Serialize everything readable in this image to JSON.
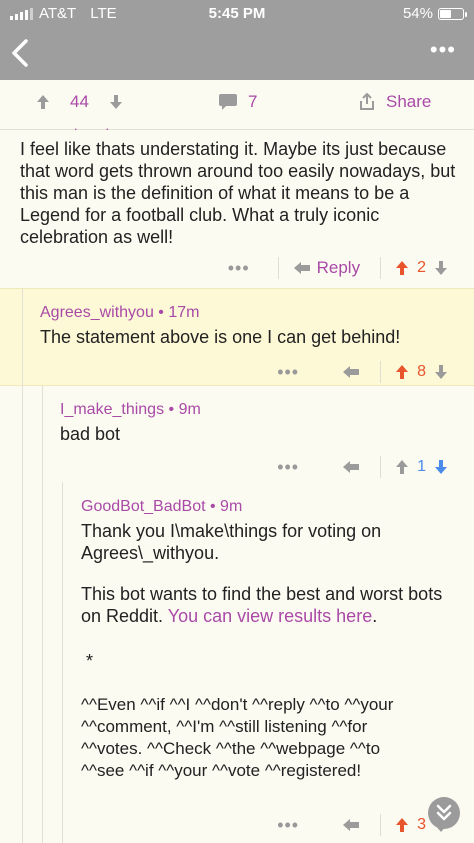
{
  "status_bar": {
    "carrier": "AT&T",
    "network": "LTE",
    "time": "5:45 PM",
    "battery": "54%",
    "battery_level": 0.54
  },
  "post_bar": {
    "upvotes": "44",
    "comments": "7",
    "share_label": "Share"
  },
  "colors": {
    "accent": "#a94aa7",
    "upvote": "#e8542b",
    "downvote": "#4a8bec",
    "icon_grey": "#9b9b9b"
  },
  "comments": [
    {
      "body": "I feel like thats understating it. Maybe its just because that word gets thrown around too easily nowadays, but this man is the definition of what it means to be a Legend for a football club. What a truly iconic celebration as well!",
      "reply_label": "Reply",
      "score": "2",
      "vote_state": "upvoted"
    },
    {
      "author": "Agrees_withyou",
      "time": "17m",
      "body": "The statement above is one I can get behind!",
      "score": "8",
      "vote_state": "upvoted"
    },
    {
      "author": "I_make_things",
      "time": "9m",
      "body": "bad bot",
      "score": "1",
      "vote_state": "downvoted"
    },
    {
      "author": "GoodBot_BadBot",
      "time": "9m",
      "body_line1": "Thank you I\\make\\things for voting on",
      "body_line2": "Agrees\\_withyou.",
      "body_para2_pre": "This bot wants to find the best and worst bots on Reddit.",
      "link_text": "You can view results here",
      "body_para2_post": ".",
      "bullet": "*",
      "footer": "^^Even ^^if ^^I ^^don't ^^reply ^^to ^^your ^^comment, ^^I'm ^^still listening ^^for ^^votes. ^^Check ^^the ^^webpage ^^to ^^see ^^if ^^your ^^vote ^^registered!",
      "score": "3",
      "vote_state": "upvoted"
    }
  ],
  "separator": " • "
}
